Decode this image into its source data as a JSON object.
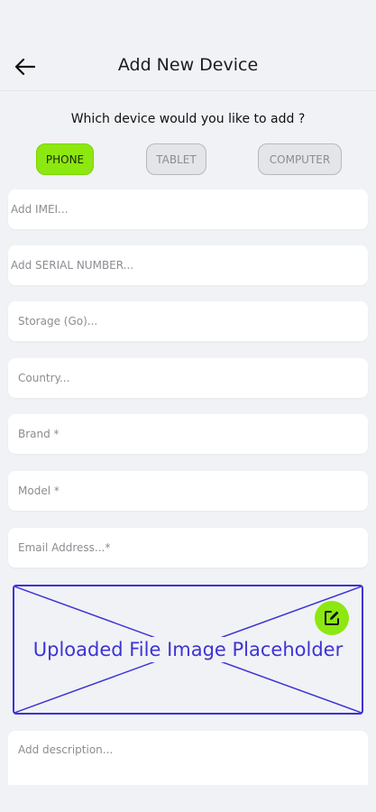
{
  "header": {
    "title": "Add New Device",
    "back_icon": "arrow-left-icon"
  },
  "device_selector": {
    "question": "Which device would you like to add ?",
    "options": [
      {
        "label": "PHONE",
        "selected": true
      },
      {
        "label": "TABLET",
        "selected": false
      },
      {
        "label": "COMPUTER",
        "selected": false
      }
    ],
    "accent_color": "#8ce810"
  },
  "form": {
    "imei_placeholder": "Add IMEI...",
    "serial_placeholder": "Add SERIAL NUMBER...",
    "storage_placeholder": "Storage (Go)...",
    "country_placeholder": "Country...",
    "brand_placeholder": "Brand *",
    "model_placeholder": "Model *",
    "email_placeholder": "Email Address...*",
    "description_placeholder": "Add description..."
  },
  "upload": {
    "label": "Uploaded File Image Placeholder",
    "edit_icon": "edit-icon",
    "border_color": "#3d33d6"
  }
}
